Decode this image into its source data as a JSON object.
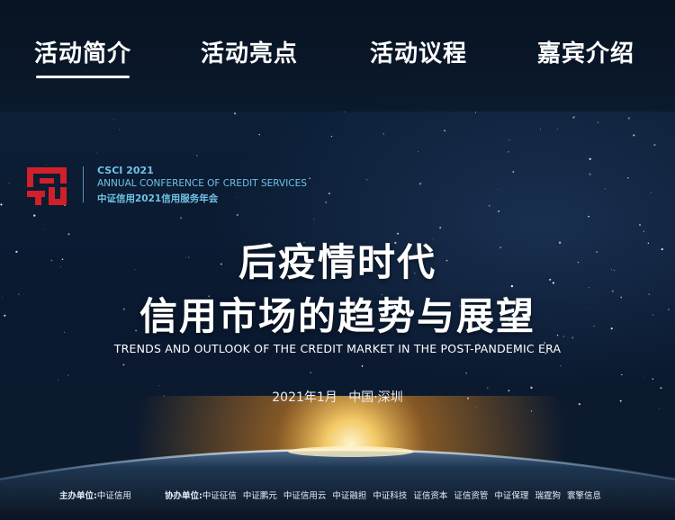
{
  "nav": {
    "items": [
      {
        "label": "活动简介",
        "active": true
      },
      {
        "label": "活动亮点",
        "active": false
      },
      {
        "label": "活动议程",
        "active": false
      },
      {
        "label": "嘉宾介绍",
        "active": false
      }
    ]
  },
  "logo": {
    "icon": "csci-red-seal-icon",
    "brand_color": "#d0202a",
    "accent_color": "#6fc3e6",
    "line1": "CSCI 2021",
    "line2": "ANNUAL CONFERENCE OF CREDIT SERVICES",
    "line3": "中证信用2021信用服务年会"
  },
  "hero": {
    "title_line1": "后疫情时代",
    "title_line2": "信用市场的趋势与展望",
    "subtitle": "TRENDS AND OUTLOOK OF THE CREDIT MARKET IN THE POST-PANDEMIC ERA",
    "date": "2021年1月",
    "location": "中国·深圳"
  },
  "footer": {
    "host_label": "主办单位:",
    "host_name": "中证信用",
    "coorg_label": "协办单位:",
    "coorgs": [
      "中证征信",
      "中证鹏元",
      "中证信用云",
      "中证融担",
      "中证科技",
      "证信资本",
      "证信资管",
      "中证保理",
      "瑞霆狗",
      "寰擎信息"
    ]
  }
}
